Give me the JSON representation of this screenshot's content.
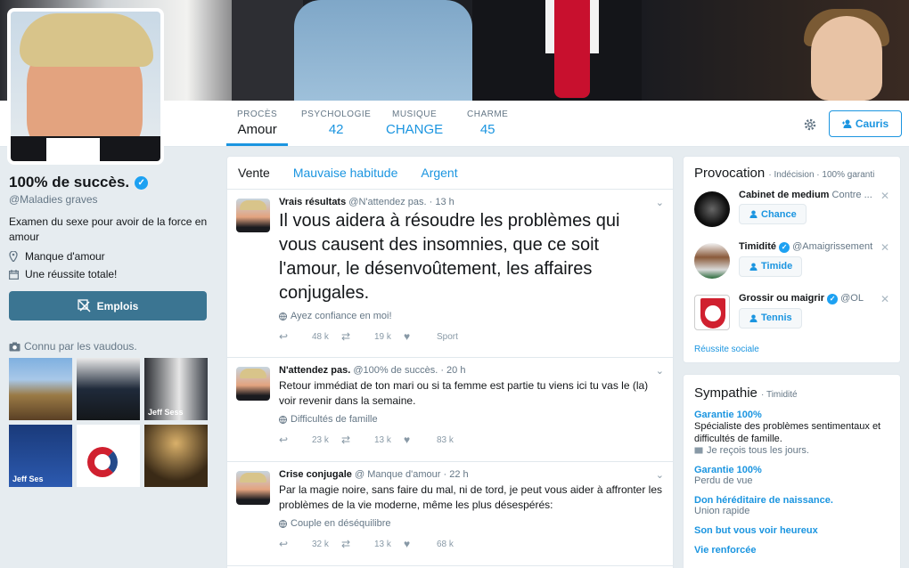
{
  "profile": {
    "name": "100% de succès.",
    "handle": "@Maladies graves",
    "bio": "Examen du sexe pour avoir de la force en amour",
    "location": "Manque d'amour",
    "joined": "Une réussite totale!",
    "jobs_button": "Emplois",
    "known_by": "Connu par les vaudous.",
    "thumb_labels": [
      "Jeff Sess",
      "Jeff Ses"
    ]
  },
  "nav": {
    "stats": [
      {
        "label": "PROCÈS",
        "value": "Amour"
      },
      {
        "label": "PSYCHOLOGIE",
        "value": "42"
      },
      {
        "label": "MUSIQUE",
        "value": "CHANGE"
      },
      {
        "label": "CHARME",
        "value": "45"
      }
    ],
    "follow_button": "Cauris"
  },
  "timeline": {
    "tabs": [
      "Vente",
      "Mauvaise habitude",
      "Argent"
    ],
    "tweets": [
      {
        "name": "Vrais résultats",
        "handle": "@N'attendez pas.",
        "time": "· 13 h",
        "text": "Il vous aidera à résoudre les problèmes qui vous causent des insomnies, que ce soit l'amour, le désenvoûtement, les affaires conjugales.",
        "location": "Ayez confiance en moi!",
        "replies": "48 k",
        "retweets": "19 k",
        "likes": "Sport"
      },
      {
        "name": "N'attendez pas.",
        "handle": "@100% de succès.",
        "time": "· 20 h",
        "text": "Retour immédiat de ton mari ou si ta femme est partie tu viens ici tu vas le (la) voir revenir dans la semaine.",
        "location": "Difficultés de famille",
        "replies": "23 k",
        "retweets": "13 k",
        "likes": "83 k"
      },
      {
        "name": "Crise conjugale",
        "handle": "@ Manque d'amour",
        "time": "· 22 h",
        "text": "Par la magie noire, sans faire du mal, ni de tord, je peut vous aider à affronter les problèmes de la vie moderne, même les plus désespérés:",
        "location": "Couple en déséquilibre",
        "replies": "32 k",
        "retweets": "13 k",
        "likes": "68 k"
      }
    ]
  },
  "who_to_follow": {
    "title": "Provocation",
    "subtitle": "· Indécision · 100% garanti",
    "items": [
      {
        "name": "Cabinet de medium",
        "handle": "Contre ...",
        "button": "Chance"
      },
      {
        "name": "Timidité",
        "handle": "@Amaigrissement",
        "button": "Timide"
      },
      {
        "name": "Grossir ou maigrir",
        "handle": "@OL",
        "button": "Tennis"
      }
    ],
    "footer": "Réussite sociale"
  },
  "trends": {
    "title": "Sympathie",
    "subtitle": "· Timidité",
    "items": [
      {
        "title": "Garantie 100%",
        "desc": "Spécialiste des problèmes sentimentaux et difficultés de famille.",
        "meta": "Je reçois tous les jours."
      },
      {
        "title": "Garantie 100%",
        "desc": "",
        "meta": "Perdu de vue"
      },
      {
        "title": "Don héréditaire de naissance.",
        "desc": "",
        "meta": "Union rapide"
      },
      {
        "title": "Son but vous voir heureux",
        "desc": "",
        "meta": ""
      },
      {
        "title": "Vie renforcée",
        "desc": "",
        "meta": ""
      }
    ]
  },
  "colors": {
    "accent": "#1b95e0",
    "jobs_button": "#3b7592",
    "background": "#e6ecf0"
  }
}
